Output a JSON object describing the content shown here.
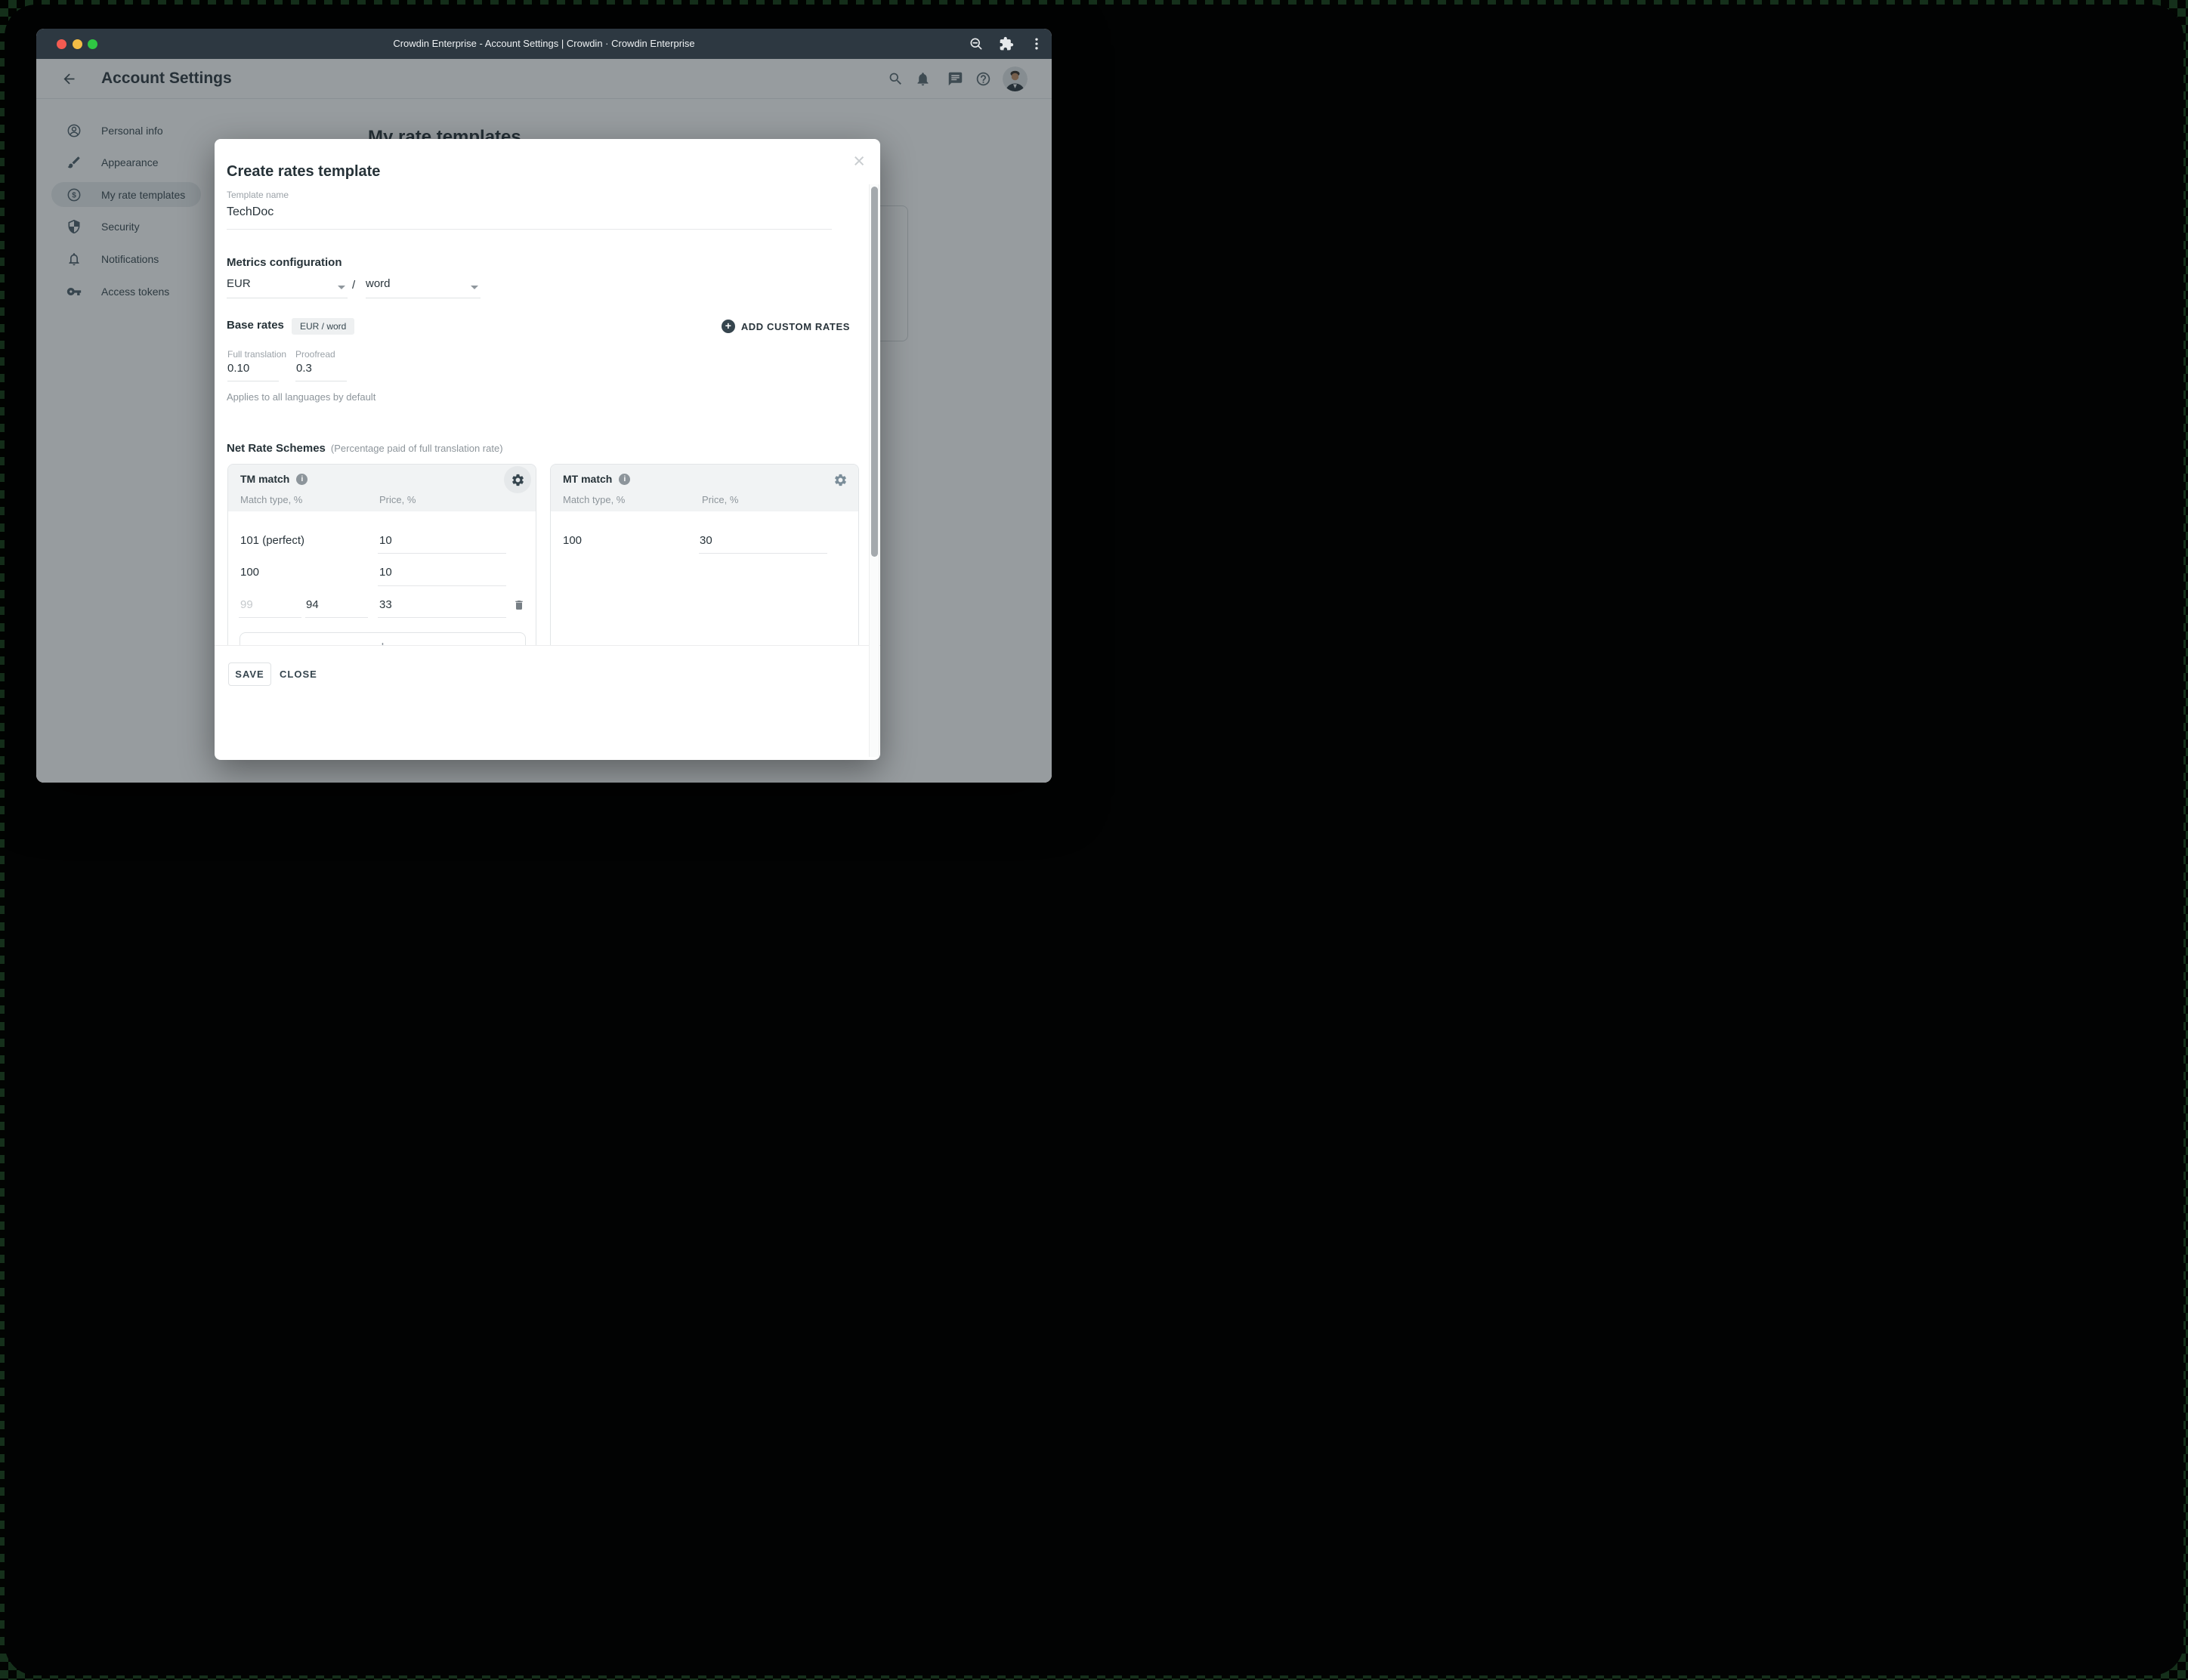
{
  "browser": {
    "window_title": "Crowdin Enterprise - Account Settings | Crowdin · Crowdin Enterprise"
  },
  "app_header": {
    "title": "Account Settings"
  },
  "sidebar": {
    "items": [
      {
        "label": "Personal info",
        "icon": "person-icon",
        "active": false
      },
      {
        "label": "Appearance",
        "icon": "brush-icon",
        "active": false
      },
      {
        "label": "My rate templates",
        "icon": "dollar-icon",
        "active": true
      },
      {
        "label": "Security",
        "icon": "shield-icon",
        "active": false
      },
      {
        "label": "Notifications",
        "icon": "bell-icon",
        "active": false
      },
      {
        "label": "Access tokens",
        "icon": "key-icon",
        "active": false
      }
    ]
  },
  "page": {
    "heading": "My rate templates"
  },
  "modal": {
    "title": "Create rates template",
    "template_name": {
      "label": "Template name",
      "value": "TechDoc"
    },
    "metrics": {
      "heading": "Metrics configuration",
      "currency": "EUR",
      "separator": "/",
      "unit": "word"
    },
    "base_rates": {
      "heading": "Base rates",
      "chip": "EUR / word",
      "add_button": "ADD CUSTOM RATES",
      "full_translation": {
        "label": "Full translation",
        "value": "0.10"
      },
      "proofread": {
        "label": "Proofread",
        "value": "0.3"
      },
      "note": "Applies to all languages by default"
    },
    "net_rate_schemes": {
      "heading": "Net Rate Schemes",
      "subheading": "(Percentage paid of full translation rate)",
      "tm_card": {
        "title": "TM match",
        "col_match": "Match type, %",
        "col_price": "Price, %",
        "rows": [
          {
            "match": "101 (perfect)",
            "price": "10"
          },
          {
            "match": "100",
            "price": "10"
          },
          {
            "match_from": "99",
            "match_to": "94",
            "price": "33"
          }
        ]
      },
      "mt_card": {
        "title": "MT match",
        "col_match": "Match type, %",
        "col_price": "Price, %",
        "rows": [
          {
            "match": "100",
            "price": "30"
          }
        ]
      }
    },
    "footer": {
      "save": "SAVE",
      "close": "CLOSE"
    }
  },
  "colors": {
    "titlebar": "#2d3841",
    "backdrop": "rgba(35,45,52,0.47)",
    "text_primary": "#263238",
    "text_muted": "#8d959b",
    "card_header": "#f1f3f4",
    "chip_bg": "#eef0f1",
    "traffic_red": "#f45b51",
    "traffic_yellow": "#f4bd45",
    "traffic_green": "#2fc643"
  }
}
